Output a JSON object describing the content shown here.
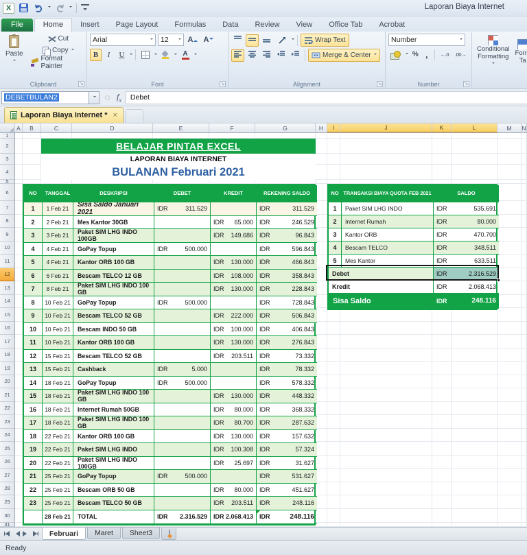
{
  "window": {
    "title": "Laporan Biaya Internet"
  },
  "ribbon": {
    "tabs": [
      "File",
      "Home",
      "Insert",
      "Page Layout",
      "Formulas",
      "Data",
      "Review",
      "View",
      "Office Tab",
      "Acrobat"
    ],
    "active_tab": "Home",
    "clipboard": {
      "group_label": "Clipboard",
      "paste": "Paste",
      "cut": "Cut",
      "copy": "Copy",
      "format_painter": "Format Painter"
    },
    "font": {
      "group_label": "Font",
      "font_name": "Arial",
      "font_size": "12",
      "bold": "B",
      "italic": "I",
      "underline": "U"
    },
    "alignment": {
      "group_label": "Alignment",
      "wrap_text": "Wrap Text",
      "merge_center": "Merge & Center"
    },
    "number": {
      "group_label": "Number",
      "format": "Number",
      "percent": "%",
      "comma": ","
    },
    "styles": {
      "conditional_line1": "Conditional",
      "conditional_line2": "Formatting",
      "format_table_line1": "Form",
      "format_table_line2": "Ta"
    }
  },
  "formula_bar": {
    "name_box": "DEBETBULAN2",
    "fx": "f",
    "fx_sub": "x",
    "formula": "Debet"
  },
  "doc_tabs": {
    "active": "Laporan Biaya Internet *",
    "close": "×"
  },
  "sheet": {
    "col_letters": [
      "A",
      "B",
      "C",
      "D",
      "E",
      "F",
      "G",
      "H",
      "I",
      "J",
      "K",
      "L",
      "M",
      "N"
    ],
    "highlighted_cols": [
      "I",
      "J",
      "K",
      "L"
    ],
    "active_row": 12,
    "visible_row_count": 31,
    "banner": "BELAJAR PINTAR EXCEL",
    "subtitle": "LAPORAN BIAYA INTERNET",
    "month_title": "BULANAN Februari 2021"
  },
  "currency": "IDR",
  "main_table": {
    "headers": [
      "NO",
      "TANGGAL",
      "DESKRIPSI",
      "DEBET",
      "KREDIT",
      "REKENING SALDO"
    ],
    "rows": [
      {
        "no": "1",
        "tanggal": "1 Feb 21",
        "deskripsi": "Sisa Saldo Januari 2021",
        "debet": "311.529",
        "kredit": "",
        "saldo": "311.529"
      },
      {
        "no": "2",
        "tanggal": "2 Feb 21",
        "deskripsi": "Mes Kantor 30GB",
        "debet": "",
        "kredit": "65.000",
        "saldo": "246.529"
      },
      {
        "no": "3",
        "tanggal": "3 Feb 21",
        "deskripsi": "Paket SIM LHG INDO 100GB",
        "debet": "",
        "kredit": "149.686",
        "saldo": "96.843"
      },
      {
        "no": "4",
        "tanggal": "4 Feb 21",
        "deskripsi": "GoPay Topup",
        "debet": "500.000",
        "kredit": "",
        "saldo": "596.843"
      },
      {
        "no": "5",
        "tanggal": "4 Feb 21",
        "deskripsi": "Kantor ORB 100 GB",
        "debet": "",
        "kredit": "130.000",
        "saldo": "466.843"
      },
      {
        "no": "6",
        "tanggal": "6 Feb 21",
        "deskripsi": "Bescam TELCO 12 GB",
        "debet": "",
        "kredit": "108.000",
        "saldo": "358.843"
      },
      {
        "no": "7",
        "tanggal": "8 Feb 21",
        "deskripsi": "Paket SIM LHG INDO 100 GB",
        "debet": "",
        "kredit": "130.000",
        "saldo": "228.843"
      },
      {
        "no": "8",
        "tanggal": "10 Feb 21",
        "deskripsi": "GoPay Topup",
        "debet": "500.000",
        "kredit": "",
        "saldo": "728.843"
      },
      {
        "no": "9",
        "tanggal": "10 Feb 21",
        "deskripsi": "Bescam TELCO 52 GB",
        "debet": "",
        "kredit": "222.000",
        "saldo": "506.843"
      },
      {
        "no": "10",
        "tanggal": "10 Feb 21",
        "deskripsi": "Bescam INDO 50 GB",
        "debet": "",
        "kredit": "100.000",
        "saldo": "406.843"
      },
      {
        "no": "11",
        "tanggal": "10 Feb 21",
        "deskripsi": "Kantor ORB 100 GB",
        "debet": "",
        "kredit": "130.000",
        "saldo": "276.843"
      },
      {
        "no": "12",
        "tanggal": "15 Feb 21",
        "deskripsi": "Bescam TELCO 52 GB",
        "debet": "",
        "kredit": "203.511",
        "saldo": "73.332"
      },
      {
        "no": "13",
        "tanggal": "15 Feb 21",
        "deskripsi": "Cashback",
        "debet": "5.000",
        "kredit": "",
        "saldo": "78.332"
      },
      {
        "no": "14",
        "tanggal": "18 Feb 21",
        "deskripsi": "GoPay Topup",
        "debet": "500.000",
        "kredit": "",
        "saldo": "578.332"
      },
      {
        "no": "15",
        "tanggal": "18 Feb 21",
        "deskripsi": "Paket SIM LHG INDO 100 GB",
        "debet": "",
        "kredit": "130.000",
        "saldo": "448.332"
      },
      {
        "no": "16",
        "tanggal": "18 Feb 21",
        "deskripsi": "Internet Rumah 50GB",
        "debet": "",
        "kredit": "80.000",
        "saldo": "368.332"
      },
      {
        "no": "17",
        "tanggal": "18 Feb 21",
        "deskripsi": "Paket SIM LHG INDO 100 GB",
        "debet": "",
        "kredit": "80.700",
        "saldo": "287.632"
      },
      {
        "no": "18",
        "tanggal": "22 Feb 21",
        "deskripsi": "Kantor ORB 100 GB",
        "debet": "",
        "kredit": "130.000",
        "saldo": "157.632"
      },
      {
        "no": "19",
        "tanggal": "22 Feb 21",
        "deskripsi": "Paket SIM LHG INDO",
        "debet": "",
        "kredit": "100.308",
        "saldo": "57.324"
      },
      {
        "no": "20",
        "tanggal": "22 Feb 21",
        "deskripsi": "Paket SIM LHG INDO 100GB",
        "debet": "",
        "kredit": "25.697",
        "saldo": "31.627"
      },
      {
        "no": "21",
        "tanggal": "25 Feb 21",
        "deskripsi": "GoPay Topup",
        "debet": "500.000",
        "kredit": "",
        "saldo": "531.627"
      },
      {
        "no": "22",
        "tanggal": "25 Feb 21",
        "deskripsi": "Bescam ORB 50 GB",
        "debet": "",
        "kredit": "80.000",
        "saldo": "451.627"
      },
      {
        "no": "23",
        "tanggal": "25 Feb 21",
        "deskripsi": "Bescam TELCO 50 GB",
        "debet": "",
        "kredit": "203.511",
        "saldo": "248.116"
      }
    ],
    "total_row": {
      "tanggal": "28 Feb 21",
      "label": "TOTAL",
      "debet": "2.316.529",
      "kredit": "2.068.413",
      "saldo": "248.116"
    }
  },
  "summary_table": {
    "headers": [
      "NO",
      "TRANSAKSI BIAYA QUOTA FEB 2021",
      "SALDO"
    ],
    "rows": [
      {
        "no": "1",
        "label": "Paket SIM LHG INDO",
        "saldo": "535.691"
      },
      {
        "no": "2",
        "label": "Internet Rumah",
        "saldo": "80.000"
      },
      {
        "no": "3",
        "label": "Kantor ORB",
        "saldo": "470.700"
      },
      {
        "no": "4",
        "label": "Bescam TELCO",
        "saldo": "348.511"
      },
      {
        "no": "5",
        "label": "Mes Kantor",
        "saldo": "633.511"
      }
    ],
    "debet_row": {
      "label": "Debet",
      "value": "2.316.529"
    },
    "kredit_row": {
      "label": "Kredit",
      "value": "2.068.413"
    },
    "sisa_row": {
      "label": "Sisa Saldo",
      "value": "248.116"
    }
  },
  "sheet_tabs": {
    "tabs": [
      "Februari",
      "Maret",
      "Sheet3"
    ],
    "active": "Februari"
  },
  "status_bar": {
    "text": "Ready"
  },
  "colors": {
    "table_green": "#11A346",
    "band_green": "#E4F2DA",
    "band_cream": "#F8F5E4",
    "selection_fill": "#9FCCC3",
    "header_highlight": "#F7CE63",
    "month_title_blue": "#2E5FA3"
  }
}
